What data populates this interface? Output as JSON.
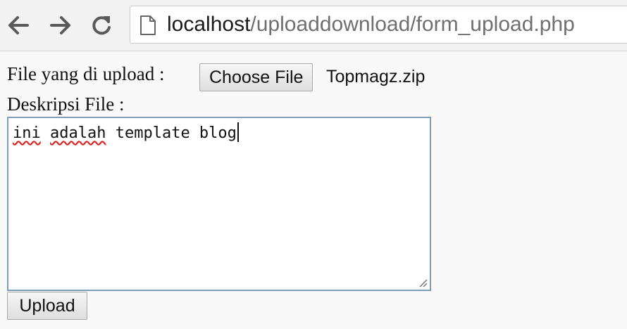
{
  "browser": {
    "url_host": "localhost",
    "url_path": "/uploaddownload/form_upload.php",
    "icons": [
      "back-icon",
      "forward-icon",
      "reload-icon",
      "page-icon"
    ]
  },
  "form": {
    "file_label": "File yang di upload :",
    "choose_file_label": "Choose File",
    "selected_file": "Topmagz.zip",
    "description_label": "Deskripsi File :",
    "description_words": [
      "ini",
      " ",
      "adalah",
      " template blog"
    ],
    "upload_label": "Upload"
  }
}
